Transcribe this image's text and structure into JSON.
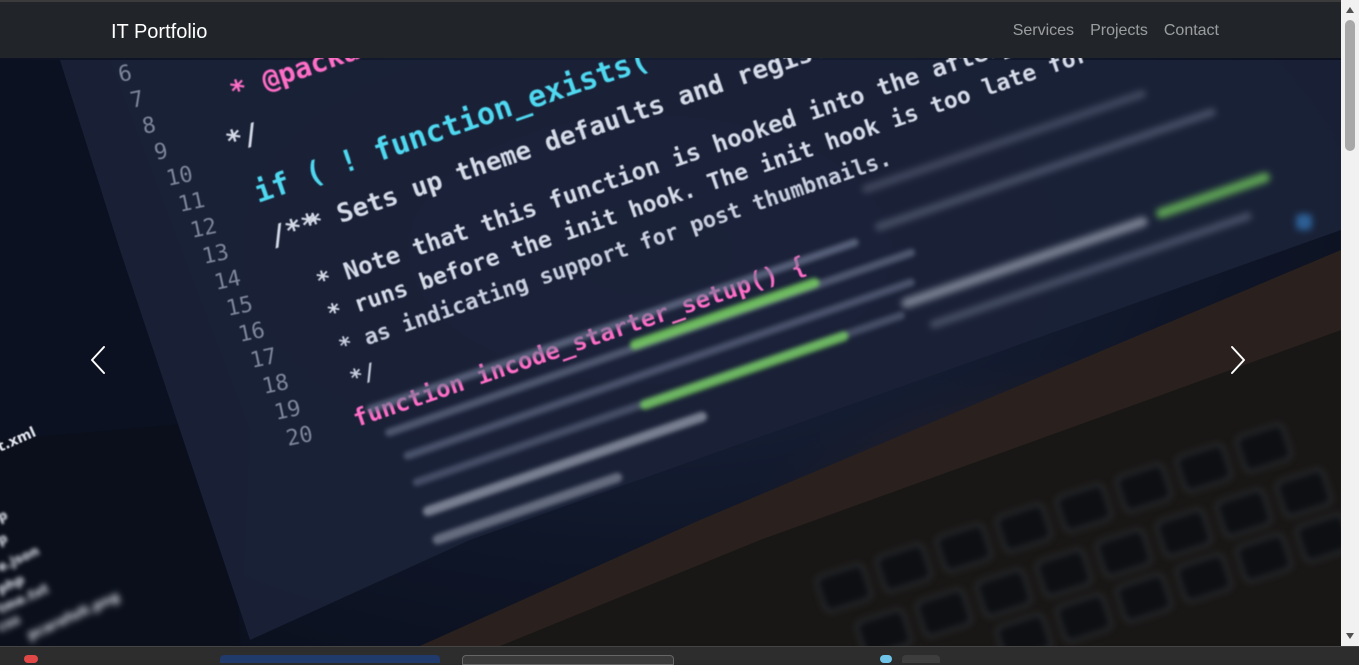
{
  "navbar": {
    "brand": "IT Portfolio",
    "links": [
      {
        "label": "Services"
      },
      {
        "label": "Projects"
      },
      {
        "label": "Contact"
      }
    ]
  },
  "carousel": {
    "prev_icon": "chevron-left-icon",
    "next_icon": "chevron-right-icon"
  },
  "hero_image": {
    "line_numbers": [
      "6",
      "7",
      "8",
      "9",
      "10",
      "11",
      "12",
      "13",
      "14",
      "15",
      "16",
      "17",
      "18",
      "19",
      "20"
    ],
    "code_lines": [
      "* @packa",
      "*/",
      "if ( ! function_exists( 'in",
      "/**",
      "* Sets up theme defaults and registers",
      "* Note that this function is hooked into the after_",
      "* runs before the init hook. The init hook is too late for",
      "* as indicating support for post thumbnails.",
      "*/",
      "function incode_starter_setup() {"
    ],
    "sidebar_files": [
      "t.xml",
      "p",
      "p",
      "e.json",
      "php",
      "tme.txt",
      "css",
      "pcarefolt.png"
    ]
  },
  "colors": {
    "navbar_bg": "#212529",
    "brand": "#ffffff",
    "nav_link": "rgba(255,255,255,0.55)",
    "code_keyword": "#ff6ec7",
    "code_function": "#4fd8f0",
    "code_comment": "#d6dbe8",
    "code_string": "#8be36a"
  }
}
